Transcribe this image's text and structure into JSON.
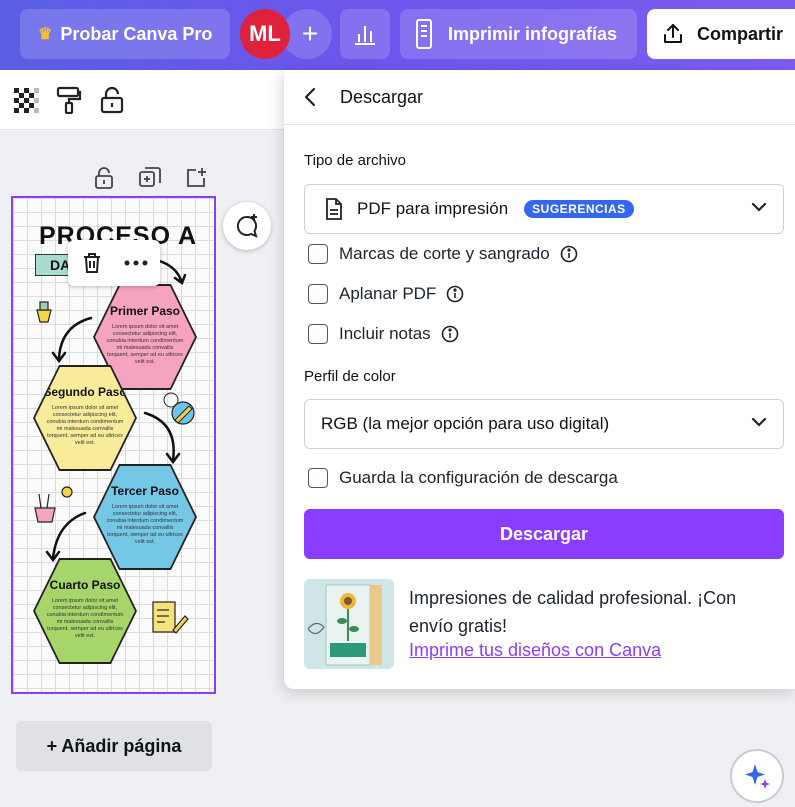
{
  "topbar": {
    "pro_label": "Probar Canva Pro",
    "avatar_initials": "ML",
    "add_collaborator": "+",
    "print_label": "Imprimir infografías",
    "share_label": "Compartir",
    "gradient_start": "#5b5fe6",
    "gradient_end": "#7c5cf0"
  },
  "canvas": {
    "design_title": "PROCESO A",
    "design_subtitle": "DA",
    "steps": [
      {
        "title": "Primer Paso",
        "text": "Lorem ipsum dolor sit amet consectetur adipiscing elit, conubia interdum condimentum mi malesuada convallis torquent, semper ad eu ultrices velit est.",
        "color": "#f6a3c0"
      },
      {
        "title": "Segundo Paso",
        "text": "Lorem ipsum dolor sit amet consectetur adipiscing elit, conubia interdum condimentum mi malesuada convallis torquent, semper ad eu ultrices velit est.",
        "color": "#f8ec9a"
      },
      {
        "title": "Tercer Paso",
        "text": "Lorem ipsum dolor sit amet consectetur adipiscing elit, conubia interdum condimentum mi malesuada convallis torquent, semper ad eu ultrices velit est.",
        "color": "#74c8e6"
      },
      {
        "title": "Cuarto Paso",
        "text": "Lorem ipsum dolor sit amet consectetur adipiscing elit, conubia interdum condimentum mi malesuada convallis torquent, semper ad eu ultrices velit est.",
        "color": "#a6d66a"
      }
    ],
    "add_page_label": "+ Añadir página",
    "selection_color": "#8b3dff"
  },
  "download_panel": {
    "title": "Descargar",
    "file_type_label": "Tipo de archivo",
    "file_type_value": "PDF para impresión",
    "suggestion_badge": "SUGERENCIAS",
    "options": [
      {
        "label": "Marcas de corte y sangrado",
        "checked": false
      },
      {
        "label": "Aplanar PDF",
        "checked": false
      },
      {
        "label": "Incluir notas",
        "checked": false
      }
    ],
    "color_profile_label": "Perfil de color",
    "color_profile_value": "RGB (la mejor opción para uso digital)",
    "save_settings_label": "Guarda la configuración de descarga",
    "save_settings_checked": false,
    "download_button": "Descargar",
    "promo_text": "Impresiones de calidad profesional. ¡Con envío gratis!",
    "promo_link": "Imprime tus diseños con Canva",
    "accent_color": "#8b3dff",
    "badge_color": "#3567ee"
  }
}
